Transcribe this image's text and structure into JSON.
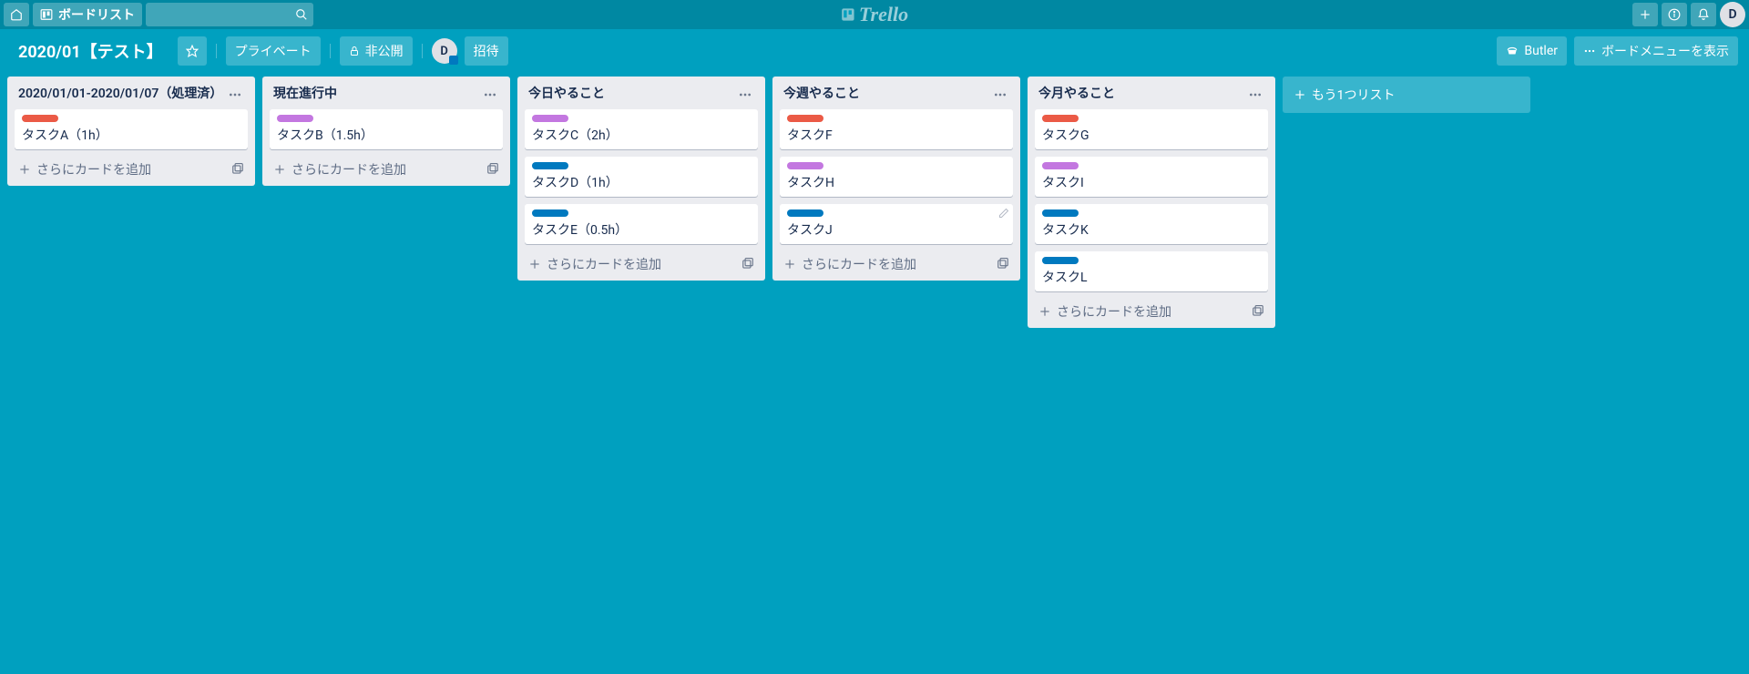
{
  "topbar": {
    "boards_label": "ボードリスト",
    "logo_text": "Trello",
    "avatar_initial": "D"
  },
  "boardbar": {
    "title": "2020/01【テスト】",
    "private_label": "プライベート",
    "visibility_label": "非公開",
    "member_initial": "D",
    "invite_label": "招待",
    "butler_label": "Butler",
    "menu_label": "ボードメニューを表示"
  },
  "lists": [
    {
      "title": "2020/01/01-2020/01/07（処理済）",
      "cards": [
        {
          "label_color": "orange",
          "title": "タスクA（1h）",
          "edit": false
        }
      ]
    },
    {
      "title": "現在進行中",
      "cards": [
        {
          "label_color": "purple",
          "title": "タスクB（1.5h）",
          "edit": false
        }
      ]
    },
    {
      "title": "今日やること",
      "cards": [
        {
          "label_color": "purple",
          "title": "タスクC（2h）",
          "edit": false
        },
        {
          "label_color": "blue",
          "title": "タスクD（1h）",
          "edit": false
        },
        {
          "label_color": "blue",
          "title": "タスクE（0.5h）",
          "edit": false
        }
      ]
    },
    {
      "title": "今週やること",
      "cards": [
        {
          "label_color": "orange",
          "title": "タスクF",
          "edit": false
        },
        {
          "label_color": "purple",
          "title": "タスクH",
          "edit": false
        },
        {
          "label_color": "blue",
          "title": "タスクJ",
          "edit": true
        }
      ]
    },
    {
      "title": "今月やること",
      "cards": [
        {
          "label_color": "orange",
          "title": "タスクG",
          "edit": false
        },
        {
          "label_color": "purple",
          "title": "タスクI",
          "edit": false
        },
        {
          "label_color": "blue",
          "title": "タスクK",
          "edit": false
        },
        {
          "label_color": "blue",
          "title": "タスクL",
          "edit": false
        }
      ]
    }
  ],
  "strings": {
    "add_card": "さらにカードを追加",
    "add_list": "もう1つリスト"
  }
}
